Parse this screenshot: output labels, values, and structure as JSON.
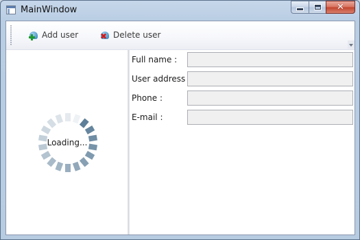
{
  "window": {
    "title": "MainWindow"
  },
  "toolbar": {
    "add_label": "Add user",
    "delete_label": "Delete user"
  },
  "loader": {
    "text": "Loading...",
    "segment_count": 18
  },
  "form": {
    "fields": [
      {
        "label": "Full name :",
        "value": ""
      },
      {
        "label": "User address :",
        "value": ""
      },
      {
        "label": "Phone :",
        "value": ""
      },
      {
        "label": "E-mail :",
        "value": ""
      }
    ]
  },
  "colors": {
    "spinner": "#5d7f99",
    "input_bg": "#f0f0f0",
    "close_button": "#c94a35"
  }
}
